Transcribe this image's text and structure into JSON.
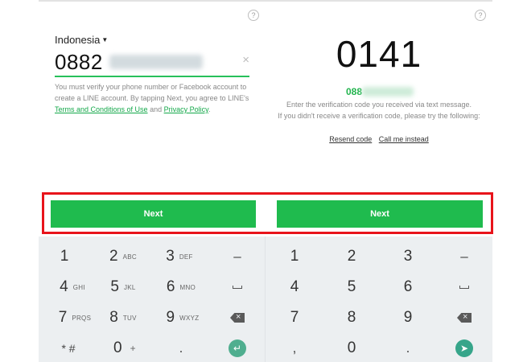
{
  "left": {
    "help": "?",
    "country": "Indonesia",
    "phone_prefix": "0882",
    "clear": "×",
    "notice_pre": "You must verify your phone number or Facebook account to create a LINE account. By tapping Next, you agree to LINE's ",
    "terms_link": "Terms and Conditions of Use",
    "and_text": " and ",
    "privacy_link": "Privacy Policy",
    "period": ".",
    "next_label": "Next"
  },
  "right": {
    "help": "?",
    "code": "0141",
    "phone_prefix": "088",
    "line1": "Enter the verification code you received via text message.",
    "line2": "If you didn't receive a verification code, please try the following:",
    "resend": "Resend code",
    "call": "Call me instead",
    "next_label": "Next"
  },
  "keypad": {
    "k1": "1",
    "k2": "2",
    "k2l": "ABC",
    "k3": "3",
    "k3l": "DEF",
    "dash": "–",
    "k4": "4",
    "k4l": "GHI",
    "k5": "5",
    "k5l": "JKL",
    "k6": "6",
    "k6l": "MNO",
    "k7": "7",
    "k7l": "PRQS",
    "k8": "8",
    "k8l": "TUV",
    "k9": "9",
    "k9l": "WXYZ",
    "star": "* #",
    "k0": "0",
    "plus": "+",
    "dot": ".",
    "comma": ",",
    "enter_icon": "↵",
    "send_icon": "➤"
  },
  "colors": {
    "brand_green": "#1fbb4e",
    "link_green": "#14a84a",
    "highlight_red": "#e8141b",
    "keyboard_bg": "#eceff1"
  }
}
